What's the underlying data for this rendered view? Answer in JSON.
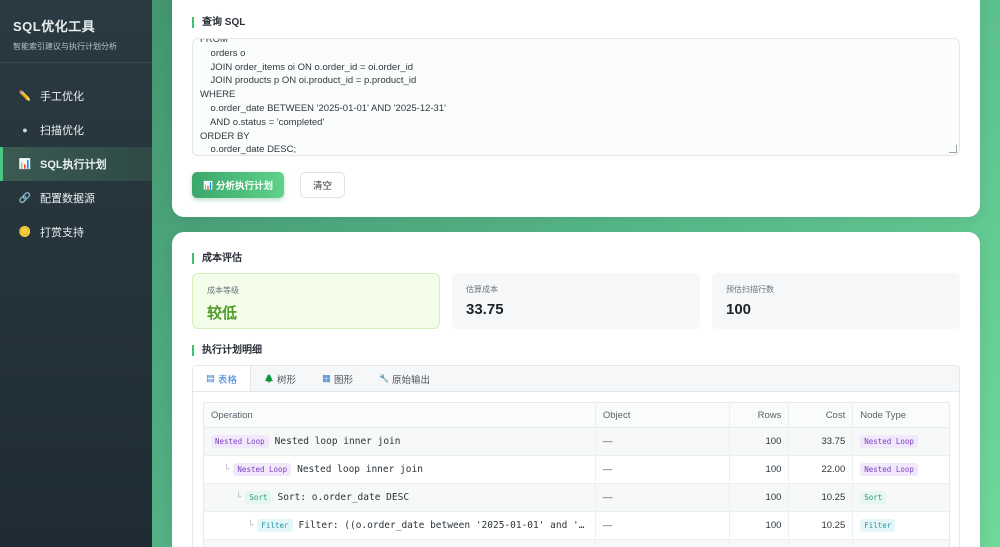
{
  "app": {
    "title": "SQL优化工具",
    "subtitle": "智能索引建议与执行计划分析"
  },
  "sidebar": {
    "items": [
      {
        "icon": "pencil-icon",
        "glyph": "✏️",
        "label": "手工优化",
        "active": false
      },
      {
        "icon": "search-icon",
        "glyph": "●",
        "label": "扫描优化",
        "active": false
      },
      {
        "icon": "chart-icon",
        "glyph": "📊",
        "label": "SQL执行计划",
        "active": true
      },
      {
        "icon": "link-icon",
        "glyph": "🔗",
        "label": "配置数据源",
        "active": false
      },
      {
        "icon": "coin-icon",
        "glyph": "🪙",
        "label": "打赏支持",
        "active": false
      }
    ]
  },
  "query": {
    "section_title": "查询 SQL",
    "sql_lines": [
      "FROM",
      "    orders o",
      "    JOIN order_items oi ON o.order_id = oi.order_id",
      "    JOIN products p ON oi.product_id = p.product_id",
      "WHERE",
      "    o.order_date BETWEEN '2025-01-01' AND '2025-12-31'",
      "    AND o.status = 'completed'",
      "ORDER BY",
      "    o.order_date DESC;"
    ],
    "analyze_icon": "📊",
    "analyze_label": "分析执行计划",
    "clear_label": "清空"
  },
  "cost": {
    "section_title": "成本评估",
    "metrics": [
      {
        "label": "成本等级",
        "value": "较低"
      },
      {
        "label": "估算成本",
        "value": "33.75"
      },
      {
        "label": "预估扫描行数",
        "value": "100"
      }
    ]
  },
  "plan": {
    "section_title": "执行计划明细",
    "tabs": [
      {
        "glyph": "▤",
        "label": "表格"
      },
      {
        "glyph": "🌲",
        "label": "树形"
      },
      {
        "glyph": "▦",
        "label": "图形"
      },
      {
        "glyph": "🔧",
        "label": "原始输出"
      }
    ],
    "columns": [
      "Operation",
      "Object",
      "Rows",
      "Cost",
      "Node Type"
    ],
    "rows": [
      {
        "tree": "",
        "badge": "Nested Loop",
        "op": "Nested loop inner join",
        "object": "—",
        "rows": "100",
        "cost": "33.75",
        "type": "Nested Loop"
      },
      {
        "tree": "└",
        "badge": "Nested Loop",
        "op": "Nested loop inner join",
        "object": "—",
        "rows": "100",
        "cost": "22.00",
        "type": "Nested Loop"
      },
      {
        "tree": "└",
        "badge": "Sort",
        "op": "Sort: o.order_date DESC",
        "object": "—",
        "rows": "100",
        "cost": "10.25",
        "type": "Sort"
      },
      {
        "tree": "└",
        "badge": "Filter",
        "op": "Filter: ((o.order_date between '2025-01-01' and '…",
        "object": "—",
        "rows": "100",
        "cost": "10.25",
        "type": "Filter"
      },
      {
        "tree": "└",
        "badge": "",
        "op": "",
        "object": "",
        "rows": "",
        "cost": "",
        "type": ""
      }
    ]
  }
}
